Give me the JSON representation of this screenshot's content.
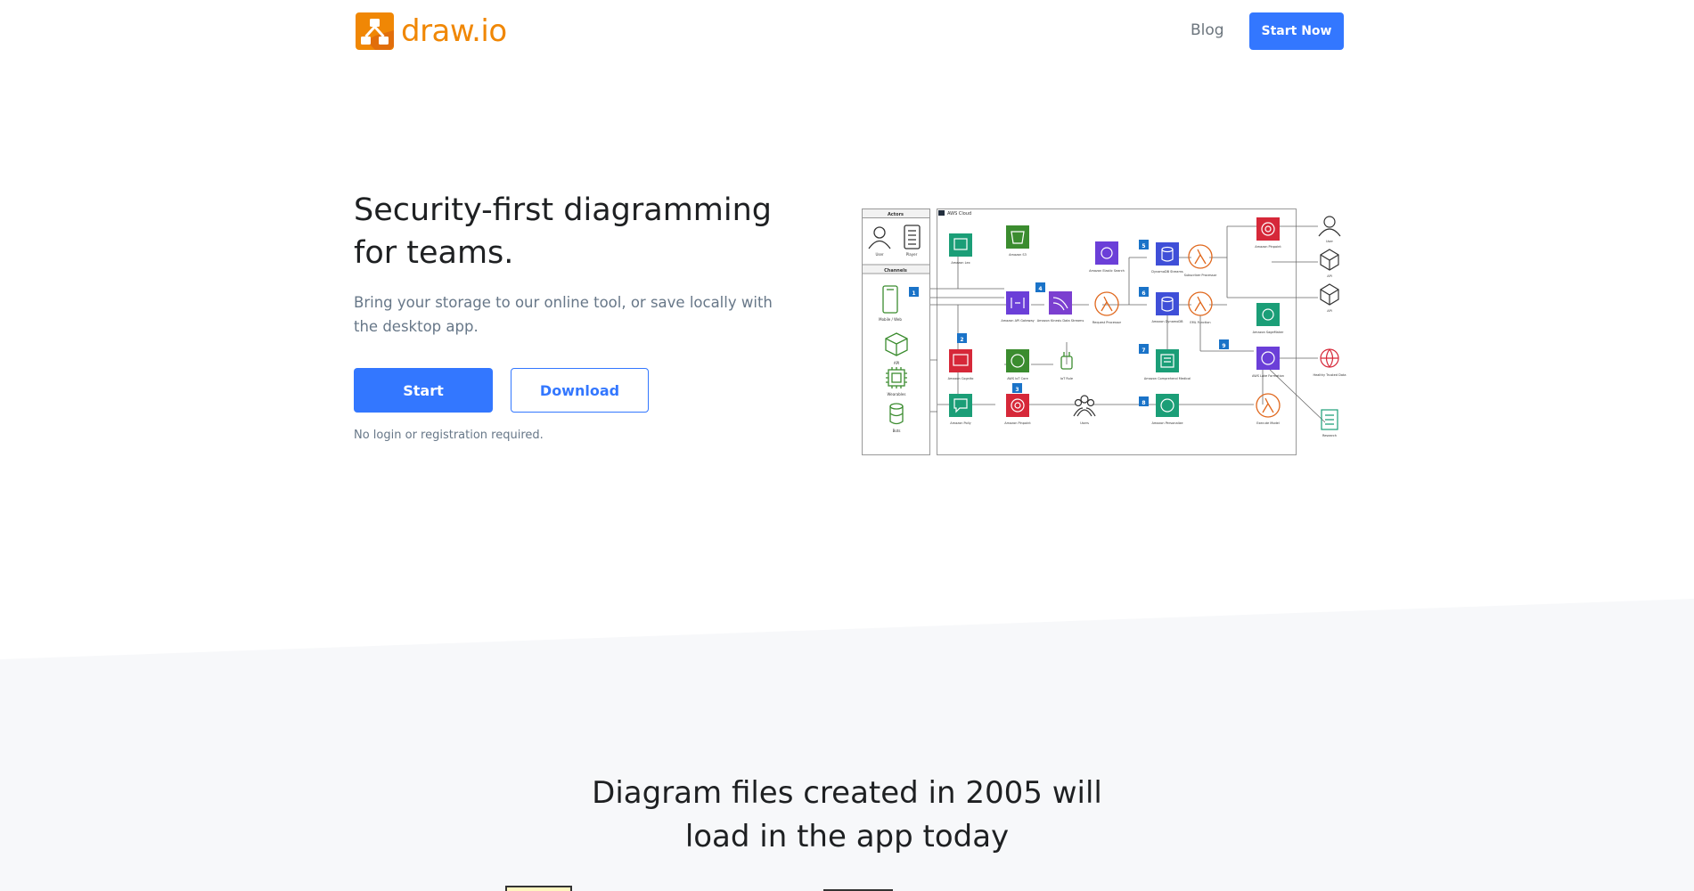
{
  "header": {
    "logo_text": "draw.io",
    "nav_blog": "Blog",
    "nav_start": "Start Now"
  },
  "hero": {
    "title": "Security-first diagramming for teams.",
    "subtitle": "Bring your storage to our online tool, or save locally with the desktop app.",
    "start_button": "Start",
    "download_button": "Download",
    "note": "No login or registration required."
  },
  "diagram": {
    "actors_label": "Actors",
    "channels_label": "Channels",
    "cloud_label": "AWS Cloud",
    "badges": [
      "1",
      "2",
      "3",
      "4",
      "5",
      "6",
      "7",
      "8",
      "9"
    ],
    "actor_labels": [
      "User",
      "Player"
    ],
    "channel_labels": [
      "Mobile / Web",
      "API",
      "Wearables",
      "Bots"
    ],
    "service_labels": [
      "Amazon Lex",
      "Amazon S3",
      "Amazon Elastic Search",
      "DynamoDB Streams",
      "Subscriber Processor",
      "Amazon Pinpoint",
      "Amazon API Gateway",
      "Amazon Kinesis Data Streams",
      "Request Processor",
      "Amazon DynamoDB",
      "EML Function",
      "Amazon SageMaker",
      "Amazon Cognito",
      "AWS IoT Core",
      "IoT Rule",
      "Amazon Comprehend Medical",
      "AWS Lake Formation",
      "Amazon Polly",
      "Amazon Pinpoint",
      "Users",
      "Amazon Personalize",
      "Execute Model"
    ],
    "right_labels": [
      "User",
      "API",
      "API",
      "Healthy Trusted Data",
      "Research"
    ]
  },
  "colors": {
    "brand_orange": "#f08705",
    "primary_blue": "#3377ff",
    "muted_text": "#677788",
    "section_bg": "#f7f8fa"
  },
  "section2": {
    "title_line1": "Diagram files created in 2005 will",
    "title_line2": "load in the app today"
  }
}
